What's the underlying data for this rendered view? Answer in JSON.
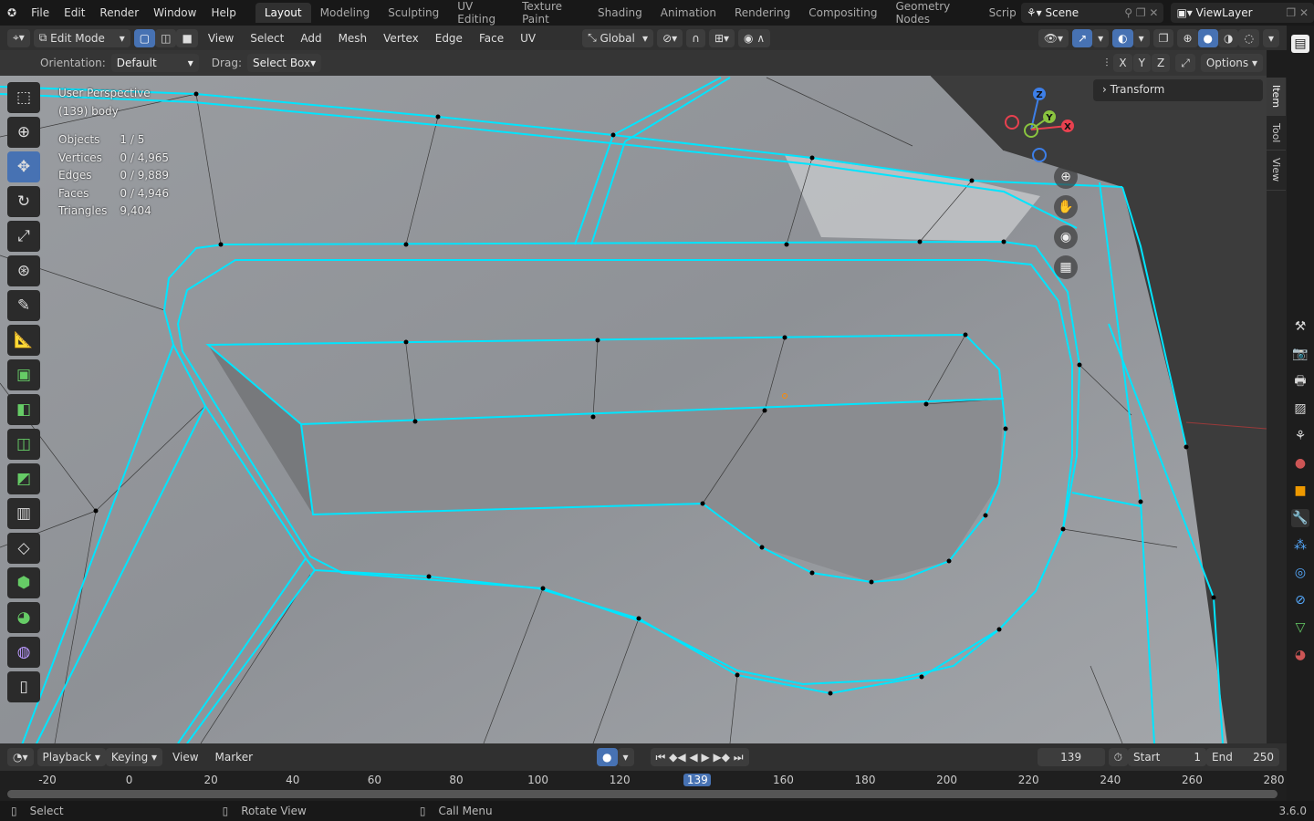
{
  "topbar": {
    "menus": [
      "File",
      "Edit",
      "Render",
      "Window",
      "Help"
    ],
    "workspaces": [
      "Layout",
      "Modeling",
      "Sculpting",
      "UV Editing",
      "Texture Paint",
      "Shading",
      "Animation",
      "Rendering",
      "Compositing",
      "Geometry Nodes",
      "Scripting"
    ],
    "active_workspace": "Layout",
    "scene": "Scene",
    "view_layer": "ViewLayer"
  },
  "viewport_header": {
    "mode": "Edit Mode",
    "menus": [
      "View",
      "Select",
      "Add",
      "Mesh",
      "Vertex",
      "Edge",
      "Face",
      "UV"
    ],
    "orientation": "Global"
  },
  "tool_settings": {
    "orientation_label": "Orientation:",
    "orientation_value": "Default",
    "drag_label": "Drag:",
    "drag_value": "Select Box",
    "axes": [
      "X",
      "Y",
      "Z"
    ],
    "options": "Options"
  },
  "overlay": {
    "view_name": "User Perspective",
    "object": "(139) body",
    "stats": [
      {
        "label": "Objects",
        "value": "1 / 5"
      },
      {
        "label": "Vertices",
        "value": "0 / 4,965"
      },
      {
        "label": "Edges",
        "value": "0 / 9,889"
      },
      {
        "label": "Faces",
        "value": "0 / 4,946"
      },
      {
        "label": "Triangles",
        "value": "9,404"
      }
    ]
  },
  "gizmo": {
    "axes": [
      "Z",
      "Y",
      "X"
    ]
  },
  "npanel": {
    "tabs": [
      "Item",
      "Tool",
      "View"
    ],
    "transform": "Transform"
  },
  "tools": [
    "select-box",
    "cursor",
    "move",
    "rotate",
    "scale",
    "transform",
    "annotate",
    "measure",
    "add-cube",
    "extrude",
    "inset",
    "bevel",
    "loop-cut",
    "knife",
    "poly-build",
    "spin",
    "smooth",
    "shrink"
  ],
  "timeline": {
    "menus": [
      "Playback",
      "Keying",
      "View",
      "Marker"
    ],
    "current_frame": "139",
    "start_label": "Start",
    "start": "1",
    "end_label": "End",
    "end": "250",
    "ticks": [
      "-20",
      "0",
      "20",
      "40",
      "60",
      "80",
      "100",
      "120",
      "139",
      "160",
      "180",
      "200",
      "220",
      "240",
      "260",
      "280"
    ]
  },
  "status": {
    "select": "Select",
    "rotate": "Rotate View",
    "menu": "Call Menu",
    "version": "3.6.0"
  },
  "colors": {
    "accent": "#4772b3",
    "edge": "#00e5ff",
    "x_axis": "#e8414f",
    "y_axis": "#8ac43f",
    "z_axis": "#3d7fe8"
  }
}
